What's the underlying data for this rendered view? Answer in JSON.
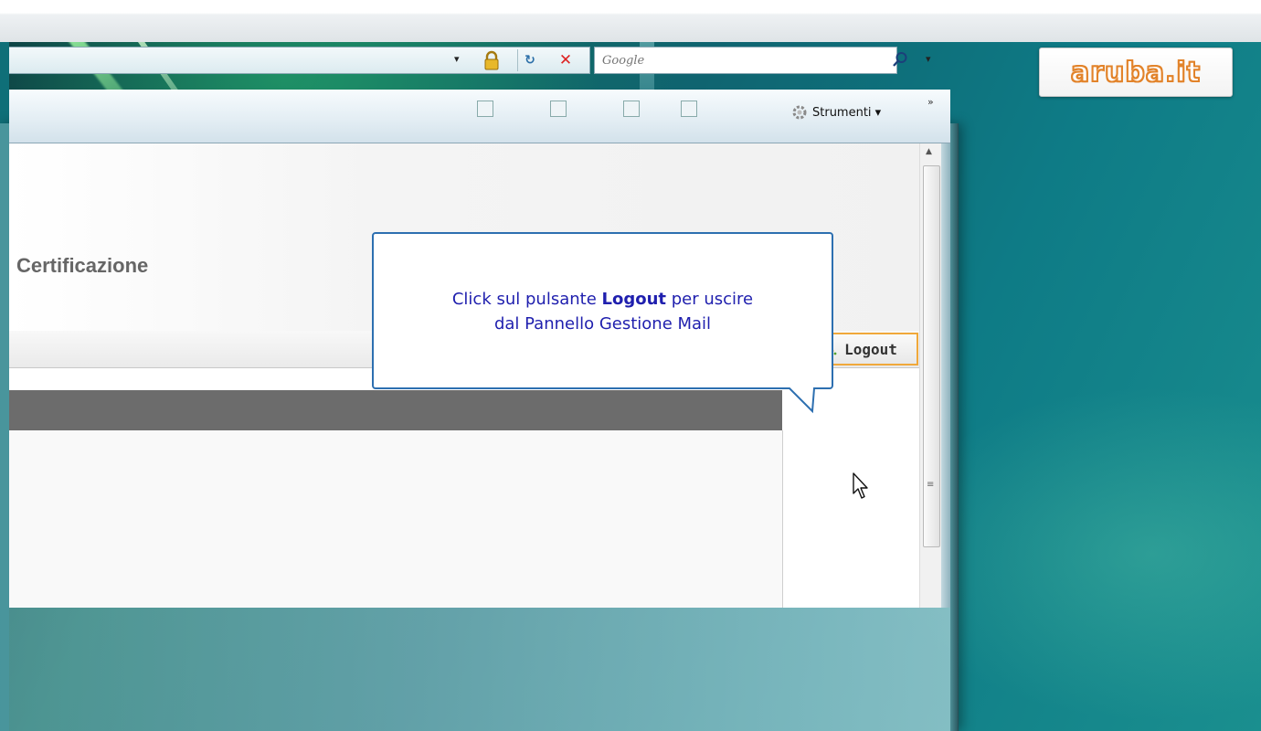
{
  "brand": {
    "logo_text": "aruba.it"
  },
  "window": {
    "caption_buttons": {
      "minimize": "—",
      "maximize": "□",
      "close": "X"
    }
  },
  "address_bar": {
    "dropdown": "▾",
    "refresh_label": "↻",
    "stop_label": "✕"
  },
  "search": {
    "placeholder": "Google",
    "dropdown": "▾"
  },
  "command_bar": {
    "tools_label": "Strumenti ▾",
    "more_label": "»"
  },
  "page": {
    "heading": "Certificazione"
  },
  "menu": {
    "logout_label": "Logout"
  },
  "tooltip": {
    "text_before": "Click sul pulsante ",
    "bold": "Logout",
    "text_after": " per uscire",
    "line2": "dal Pannello Gestione Mail"
  },
  "scrollbar": {
    "up_arrow": "▲",
    "grip": "≡"
  },
  "colors": {
    "accent_orange": "#f0a83a",
    "tooltip_text": "#1f1fae",
    "logo_orange": "#e2832a"
  },
  "icons": [
    "lock-icon",
    "refresh-icon",
    "stop-icon",
    "search-icon",
    "tools-gear-icon",
    "logout-icon",
    "mouse-cursor-icon"
  ]
}
